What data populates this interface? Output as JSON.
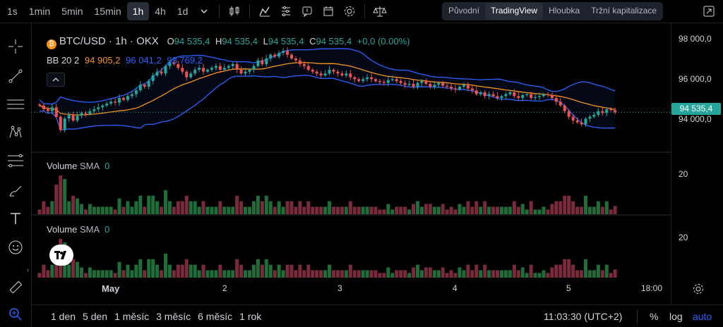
{
  "toolbar": {
    "timeframes": [
      "1s",
      "1min",
      "5min",
      "15min",
      "1h",
      "4h",
      "1d"
    ],
    "active_timeframe": "1h"
  },
  "views": {
    "items": [
      "Původní",
      "TradingView",
      "Hloubka",
      "Tržní kapitalizace"
    ],
    "active": "TradingView"
  },
  "legend": {
    "symbol": "BTC/USD · 1h · OKX",
    "o_label": "O",
    "o_value": "94 535,4",
    "h_label": "H",
    "h_value": "94 535,4",
    "l_label": "L",
    "l_value": "94 535,4",
    "c_label": "C",
    "c_value": "94 535,4",
    "change": "+0,0 (0.00%)",
    "bb_label": "BB 20 2",
    "bb_basis": "94 905,2",
    "bb_upper": "96 041,2",
    "bb_lower": "93 769,2"
  },
  "volume_panes": [
    {
      "label": "Volume",
      "sma_label": "SMA",
      "sma_value": "0",
      "axis_tick": "20"
    },
    {
      "label": "Volume",
      "sma_label": "SMA",
      "sma_value": "0",
      "axis_tick": "20"
    }
  ],
  "price_axis": {
    "ticks": [
      "98 000,0",
      "96 000,0",
      "94 000,0"
    ],
    "last_price": "94 535,4"
  },
  "time_axis": {
    "ticks": [
      "May",
      "2",
      "3",
      "4",
      "5",
      "18:00"
    ]
  },
  "bottom": {
    "ranges": [
      "1 den",
      "5 den",
      "1 měsíc",
      "3 měsíc",
      "6 měsíc",
      "1 rok"
    ],
    "clock": "11:03:30 (UTC+2)",
    "percent": "%",
    "log": "log",
    "auto": "auto"
  },
  "colors": {
    "up": "#26a69a",
    "down": "#ef5350",
    "vol_up": "#1f6e3a",
    "vol_down": "#7a2b3b",
    "bb_basis": "#f7931a",
    "bb_band": "#2962ff",
    "accent": "#2962ff"
  },
  "chart_data": {
    "type": "candlestick",
    "symbol": "BTC/USD",
    "interval": "1h",
    "ylim": [
      93200,
      98600
    ],
    "closes": [
      94900,
      94700,
      94600,
      94800,
      94300,
      93600,
      94200,
      94400,
      94100,
      94350,
      94500,
      94450,
      94600,
      94700,
      94800,
      94900,
      95000,
      95100,
      95050,
      95300,
      95200,
      95400,
      95500,
      95700,
      96000,
      95900,
      96200,
      96500,
      96700,
      96600,
      97000,
      97200,
      97100,
      96900,
      96700,
      96400,
      96600,
      96800,
      96900,
      96700,
      96800,
      96900,
      97000,
      96800,
      96900,
      97000,
      97100,
      96800,
      96600,
      96700,
      96800,
      97000,
      97300,
      97100,
      97400,
      97600,
      97500,
      97700,
      97800,
      97600,
      97400,
      97300,
      97100,
      97000,
      96800,
      96700,
      96600,
      96500,
      96600,
      96800,
      96700,
      96600,
      96500,
      96600,
      96400,
      96300,
      96200,
      96300,
      96400,
      96300,
      96200,
      96150,
      96100,
      96250,
      96300,
      96200,
      96100,
      96000,
      96050,
      95900,
      96100,
      96200,
      96050,
      95900,
      96000,
      96100,
      95950,
      95900,
      95800,
      95750,
      95900,
      96000,
      95800,
      95700,
      95500,
      95600,
      95400,
      95500,
      95400,
      95300,
      95400,
      95500,
      95600,
      95400,
      95300,
      95450,
      95500,
      95300,
      95350,
      95400,
      95500,
      95450,
      95300,
      95100,
      94900,
      94600,
      94300,
      94100,
      94000,
      93900,
      94200,
      94300,
      94400,
      94600,
      94500,
      94700,
      94650,
      94535
    ]
  }
}
